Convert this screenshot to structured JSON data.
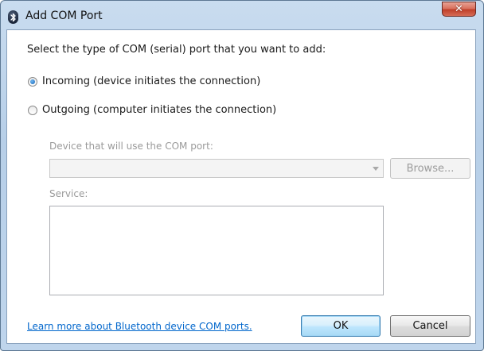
{
  "window": {
    "title": "Add COM Port",
    "title_icon": "bluetooth-icon",
    "close_icon": "close-icon",
    "close_glyph": "✕"
  },
  "dialog": {
    "prompt": "Select the type of COM (serial) port that you want to add:",
    "options": [
      {
        "label": "Incoming (device initiates the connection)",
        "selected": true
      },
      {
        "label": "Outgoing (computer initiates the connection)",
        "selected": false
      }
    ],
    "device_label": "Device that will use the COM port:",
    "device_value": "",
    "browse_label": "Browse...",
    "service_label": "Service:",
    "service_items": [],
    "learn_more_link": "Learn more about Bluetooth device COM ports.",
    "ok_label": "OK",
    "cancel_label": "Cancel"
  },
  "colors": {
    "title_bar": "#bfd5ec",
    "link": "#0066cc",
    "disabled_text": "#9a9a9a",
    "close_button": "#c0402a",
    "radio_selected": "#1565b8"
  }
}
